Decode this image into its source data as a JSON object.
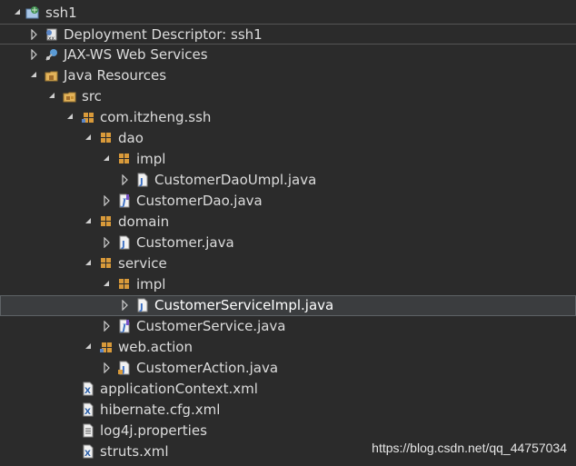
{
  "tree": {
    "items": [
      {
        "label": "ssh1",
        "twisty": "expanded",
        "icon": "web-project-icon"
      },
      {
        "label": "Deployment Descriptor: ssh1",
        "twisty": "collapsed",
        "icon": "deployment-descriptor-icon"
      },
      {
        "label": "JAX-WS Web Services",
        "twisty": "collapsed",
        "icon": "web-services-icon"
      },
      {
        "label": "Java Resources",
        "twisty": "expanded",
        "icon": "java-resources-icon"
      },
      {
        "label": "src",
        "twisty": "expanded",
        "icon": "source-folder-icon"
      },
      {
        "label": "com.itzheng.ssh",
        "twisty": "expanded",
        "icon": "package-icon"
      },
      {
        "label": "dao",
        "twisty": "expanded",
        "icon": "package-icon"
      },
      {
        "label": "impl",
        "twisty": "expanded",
        "icon": "package-icon"
      },
      {
        "label": "CustomerDaoUmpl.java",
        "twisty": "collapsed",
        "icon": "java-class-icon"
      },
      {
        "label": "CustomerDao.java",
        "twisty": "collapsed",
        "icon": "java-interface-icon"
      },
      {
        "label": "domain",
        "twisty": "expanded",
        "icon": "package-icon"
      },
      {
        "label": "Customer.java",
        "twisty": "collapsed",
        "icon": "java-class-icon"
      },
      {
        "label": "service",
        "twisty": "expanded",
        "icon": "package-icon"
      },
      {
        "label": "impl",
        "twisty": "expanded",
        "icon": "package-icon"
      },
      {
        "label": "CustomerServiceImpl.java",
        "twisty": "collapsed",
        "icon": "java-class-icon"
      },
      {
        "label": "CustomerService.java",
        "twisty": "collapsed",
        "icon": "java-interface-icon"
      },
      {
        "label": "web.action",
        "twisty": "expanded",
        "icon": "package-icon"
      },
      {
        "label": "CustomerAction.java",
        "twisty": "collapsed",
        "icon": "java-class-icon"
      },
      {
        "label": "applicationContext.xml",
        "twisty": "none",
        "icon": "xml-file-icon"
      },
      {
        "label": "hibernate.cfg.xml",
        "twisty": "none",
        "icon": "xml-file-icon"
      },
      {
        "label": "log4j.properties",
        "twisty": "none",
        "icon": "properties-file-icon"
      },
      {
        "label": "struts.xml",
        "twisty": "none",
        "icon": "xml-file-icon"
      }
    ]
  },
  "colors": {
    "background": "#2b2b2b",
    "selection": "#3b3d3f",
    "text": "#dcdcdc",
    "package": "#c8902f",
    "java": "#4a8fd8"
  },
  "watermark": "https://blog.csdn.net/qq_44757034"
}
